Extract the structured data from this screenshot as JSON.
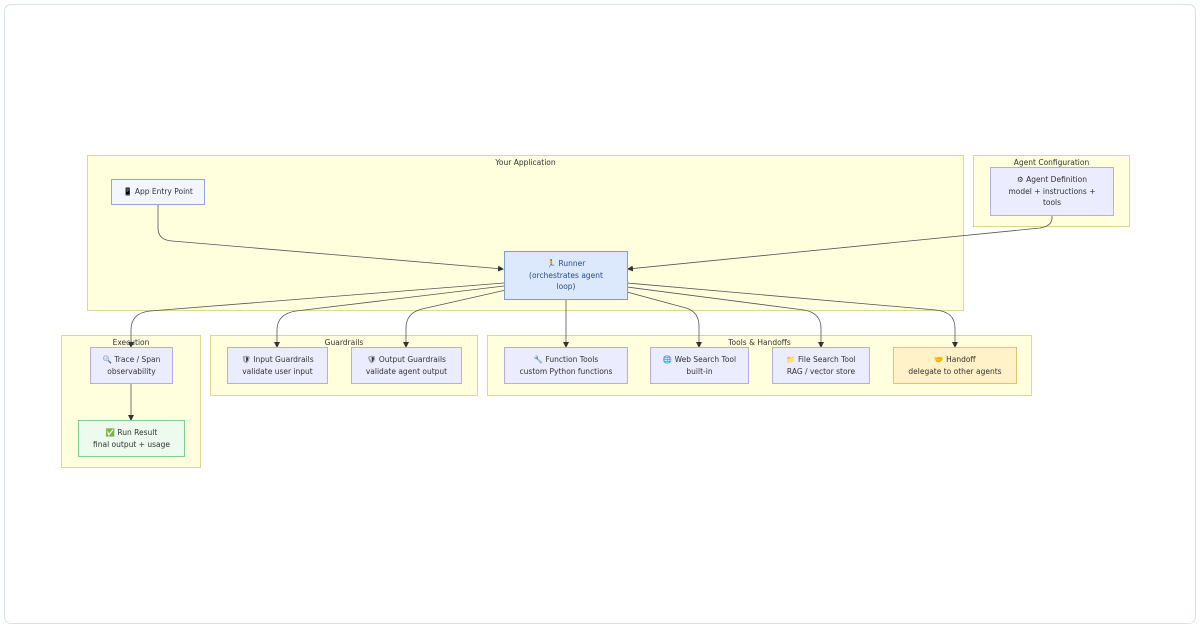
{
  "clusters": {
    "app": "Your Application",
    "config": "Agent Configuration",
    "execution": "Execution",
    "guardrails": "Guardrails",
    "tools": "Tools & Handoffs"
  },
  "nodes": {
    "entry": {
      "icon": "app-icon",
      "line1": "📱 App Entry Point"
    },
    "agent_def": {
      "icon": "gear-icon",
      "line1": "⚙ Agent Definition",
      "line2": "model + instructions +",
      "line3": "tools"
    },
    "runner": {
      "icon": "runner-icon",
      "line1": "🏃 Runner",
      "line2": "(orchestrates agent",
      "line3": "loop)"
    },
    "trace": {
      "icon": "trace-icon",
      "line1": "🔍 Trace / Span",
      "line2": "observability"
    },
    "result": {
      "icon": "result-icon",
      "line1": "✅ Run Result",
      "line2": "final output + usage"
    },
    "input_guard": {
      "icon": "shield-icon",
      "line1": "🛡 Input Guardrails",
      "line2": "validate user input"
    },
    "output_guard": {
      "icon": "shield-icon",
      "line1": "🛡 Output Guardrails",
      "line2": "validate agent output"
    },
    "function_tools": {
      "icon": "tool-icon",
      "line1": "🔧 Function Tools",
      "line2": "custom Python functions"
    },
    "web_search": {
      "icon": "globe-icon",
      "line1": "🌐 Web Search Tool",
      "line2": "built-in"
    },
    "file_search": {
      "icon": "file-icon",
      "line1": "📁 File Search Tool",
      "line2": "RAG / vector store"
    },
    "handoff": {
      "icon": "handoff-icon",
      "line1": "🤝 Handoff",
      "line2": "delegate to other agents"
    }
  },
  "colors": {
    "cluster_fill": "#ffffde",
    "node_fill": "#ececff",
    "runner_fill": "#dce8fb",
    "result_fill": "#edfbee",
    "handoff_fill": "#fff1c8",
    "edge": "#555555"
  },
  "edges": [
    [
      "entry",
      "runner"
    ],
    [
      "agent_def",
      "runner"
    ],
    [
      "runner",
      "trace"
    ],
    [
      "runner",
      "input_guard"
    ],
    [
      "runner",
      "output_guard"
    ],
    [
      "runner",
      "function_tools"
    ],
    [
      "runner",
      "web_search"
    ],
    [
      "runner",
      "file_search"
    ],
    [
      "runner",
      "handoff"
    ],
    [
      "trace",
      "result"
    ]
  ]
}
